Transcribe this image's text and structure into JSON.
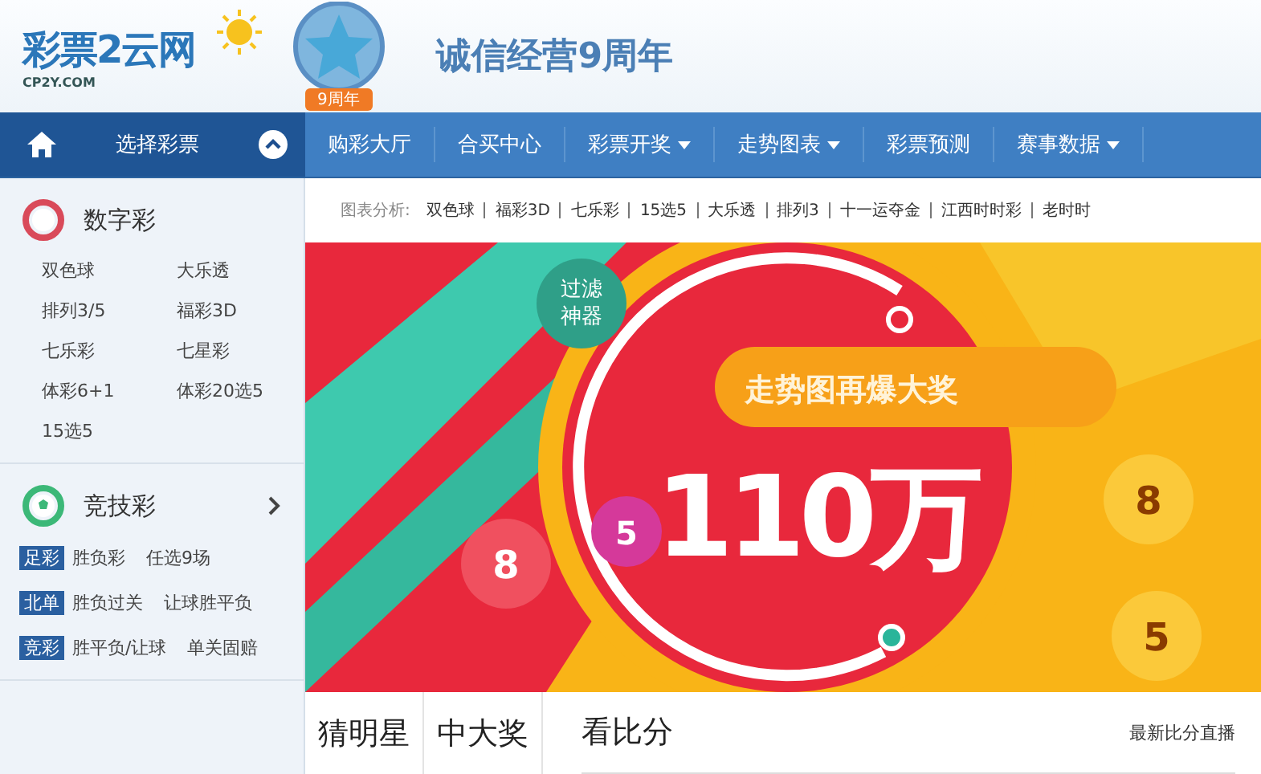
{
  "header": {
    "logo": {
      "name": "彩票2云网",
      "domain": "CP2Y.COM"
    },
    "anniversary_badge": "9周年",
    "slogan": "诚信经营9周年"
  },
  "nav": {
    "lottery_selector": "选择彩票",
    "items": [
      {
        "label": "购彩大厅",
        "has_menu": false
      },
      {
        "label": "合买中心",
        "has_menu": false
      },
      {
        "label": "彩票开奖",
        "has_menu": true
      },
      {
        "label": "走势图表",
        "has_menu": true
      },
      {
        "label": "彩票预测",
        "has_menu": false
      },
      {
        "label": "赛事数据",
        "has_menu": true
      }
    ]
  },
  "sidebar": {
    "sections": [
      {
        "kind": "digital",
        "title": "数字彩",
        "has_more": false,
        "items": [
          "双色球",
          "大乐透",
          "排列3/5",
          "福彩3D",
          "七乐彩",
          "七星彩",
          "体彩6+1",
          "体彩20选5",
          "15选5"
        ]
      },
      {
        "kind": "sports",
        "title": "竞技彩",
        "has_more": true,
        "rows": [
          {
            "tag": "足彩",
            "items": [
              "胜负彩",
              "任选9场"
            ]
          },
          {
            "tag": "北单",
            "items": [
              "胜负过关",
              "让球胜平负"
            ]
          },
          {
            "tag": "竞彩",
            "items": [
              "胜平负/让球",
              "单关固赔"
            ]
          }
        ]
      }
    ]
  },
  "chart_links": {
    "label": "图表分析:",
    "items": [
      "双色球",
      "福彩3D",
      "七乐彩",
      "15选5",
      "大乐透",
      "排列3",
      "十一运夺金",
      "江西时时彩",
      "老时时"
    ]
  },
  "banner": {
    "corner_badge": "过滤神器",
    "headline": "走势图再爆大奖",
    "amount": "110万",
    "ball_badge": "5",
    "balls": [
      "8",
      "8",
      "5"
    ]
  },
  "bottom_tabs": [
    {
      "label": "猜明星"
    },
    {
      "label": "中大奖"
    }
  ],
  "score_panel": {
    "title": "看比分",
    "link": "最新比分直播"
  }
}
